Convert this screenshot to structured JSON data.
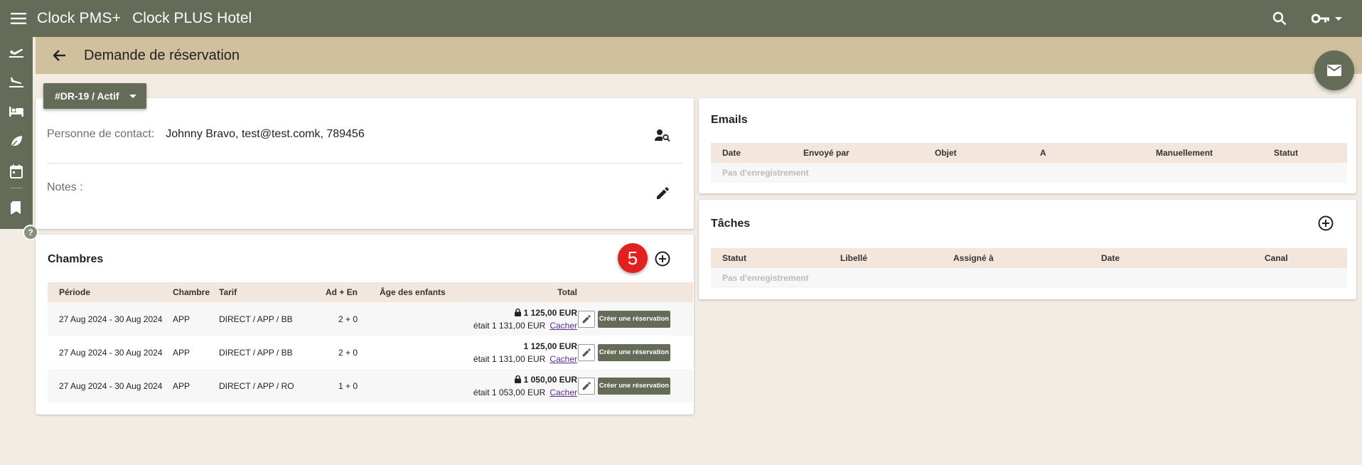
{
  "app": {
    "title": "Clock PMS+",
    "hotel": "Clock PLUS Hotel"
  },
  "topbar": {
    "icons": [
      "search-icon",
      "key-icon",
      "dropdown-caret-icon"
    ]
  },
  "sidebar": {
    "items": [
      "departures-icon",
      "arrivals-icon",
      "bed-icon",
      "leaf-icon",
      "calendar-icon",
      "bookmark-icon"
    ],
    "help": "?"
  },
  "page": {
    "title": "Demande de réservation"
  },
  "status": {
    "label": "#DR-19 / Actif"
  },
  "contact": {
    "label": "Personne de contact:",
    "value": "Johnny Bravo, test@test.comk, 789456"
  },
  "notes": {
    "label": "Notes :"
  },
  "rooms": {
    "title": "Chambres",
    "badge": "5",
    "headers": {
      "periode": "Période",
      "chambre": "Chambre",
      "tarif": "Tarif",
      "ad_en": "Ad + En",
      "age": "Âge des enfants",
      "total": "Total"
    },
    "rows": [
      {
        "periode": "27 Aug 2024 - 30 Aug 2024",
        "chambre": "APP",
        "tarif": "DIRECT / APP / BB",
        "ad_en": "2 + 0",
        "age": "",
        "total": "1 125,00 EUR",
        "locked": true,
        "was": "était 1 131,00 EUR",
        "hide": "Cacher",
        "create": "Créer une réservation"
      },
      {
        "periode": "27 Aug 2024 - 30 Aug 2024",
        "chambre": "APP",
        "tarif": "DIRECT / APP / BB",
        "ad_en": "2 + 0",
        "age": "",
        "total": "1 125,00 EUR",
        "locked": false,
        "was": "était 1 131,00 EUR",
        "hide": "Cacher",
        "create": "Créer une réservation"
      },
      {
        "periode": "27 Aug 2024 - 30 Aug 2024",
        "chambre": "APP",
        "tarif": "DIRECT / APP / RO",
        "ad_en": "1 + 0",
        "age": "",
        "total": "1 050,00 EUR",
        "locked": true,
        "was": "était 1 053,00 EUR",
        "hide": "Cacher",
        "create": "Créer une réservation"
      }
    ]
  },
  "emails": {
    "title": "Emails",
    "headers": {
      "date": "Date",
      "sent_by": "Envoyé par",
      "subject": "Objet",
      "to": "A",
      "manual": "Manuellement",
      "status": "Statut"
    },
    "empty": "Pas d'enregistrement"
  },
  "tasks": {
    "title": "Tâches",
    "headers": {
      "status": "Statut",
      "label": "Libellé",
      "assigned": "Assigné à",
      "date": "Date",
      "channel": "Canal"
    },
    "empty": "Pas d'enregistrement"
  },
  "colors": {
    "primary": "#646b57",
    "subheader": "#d0c09d",
    "background": "#f3ece4",
    "table_header": "#f3e6dc",
    "badge": "#e3201d"
  }
}
